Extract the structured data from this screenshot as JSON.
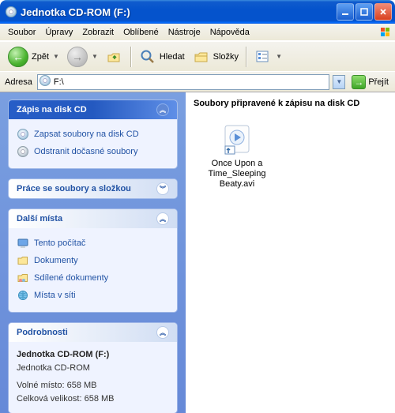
{
  "window": {
    "title": "Jednotka CD-ROM (F:)"
  },
  "menu": {
    "items": [
      "Soubor",
      "Úpravy",
      "Zobrazit",
      "Oblíbené",
      "Nástroje",
      "Nápověda"
    ]
  },
  "toolbar": {
    "back": "Zpět",
    "search": "Hledat",
    "folders": "Složky"
  },
  "address": {
    "label": "Adresa",
    "value": "F:\\",
    "go": "Přejít"
  },
  "panels": {
    "cdwrite": {
      "title": "Zápis na disk CD",
      "write": "Zapsat soubory na disk CD",
      "delete": "Odstranit dočasné soubory"
    },
    "filetasks": {
      "title": "Práce se soubory a složkou"
    },
    "places": {
      "title": "Další místa",
      "computer": "Tento počítač",
      "documents": "Dokumenty",
      "shared": "Sdílené dokumenty",
      "network": "Místa v síti"
    },
    "details": {
      "title": "Podrobnosti",
      "name": "Jednotka CD-ROM (F:)",
      "type": "Jednotka CD-ROM",
      "free": "Volné místo: 658 MB",
      "total": "Celková velikost: 658 MB"
    }
  },
  "right": {
    "header": "Soubory připravené k zápisu na disk CD",
    "file": {
      "name": "Once Upon a Time_Sleeping Beaty.avi"
    }
  }
}
